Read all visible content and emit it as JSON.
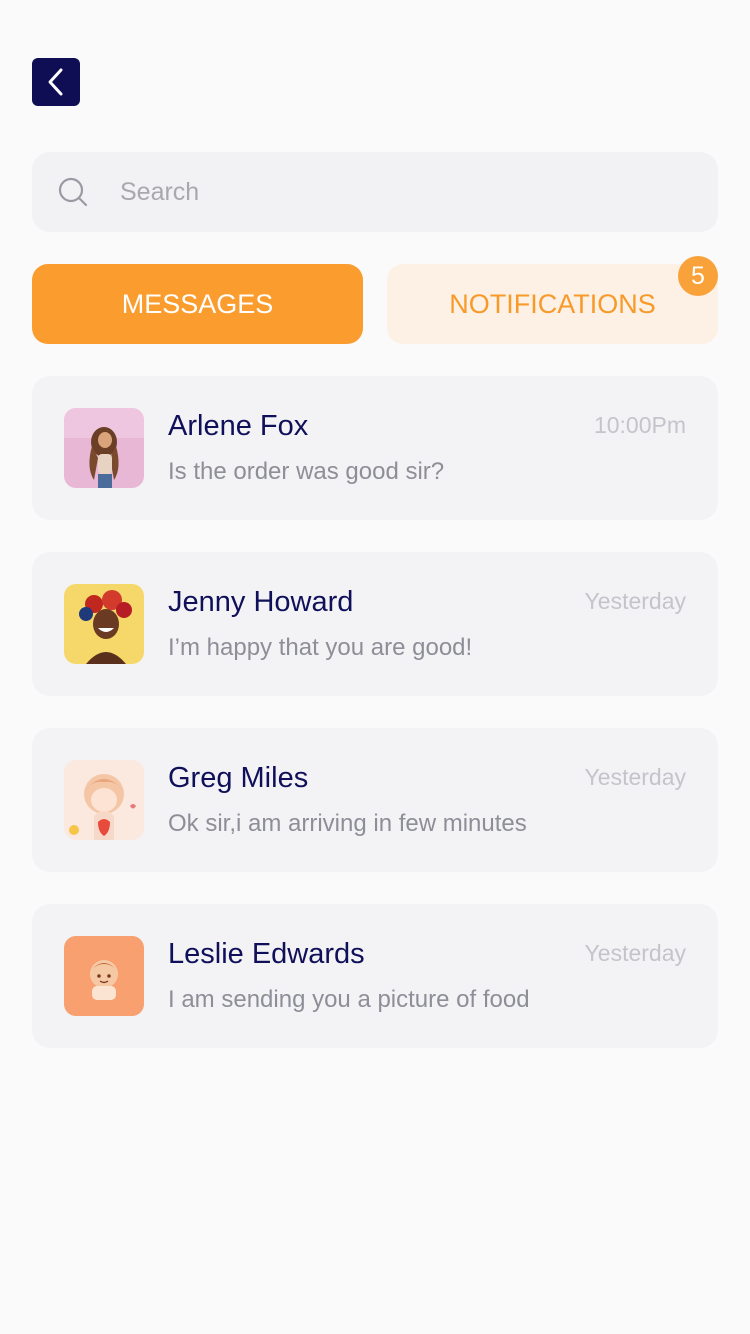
{
  "header": {
    "back_icon": "chevron-left-icon"
  },
  "search": {
    "placeholder": "Search",
    "icon": "search-icon"
  },
  "tabs": {
    "messages_label": "MESSAGES",
    "notifications_label": "NOTIFICATIONS",
    "notifications_badge": "5",
    "active": "messages"
  },
  "colors": {
    "accent": "#fb9c2e",
    "accent_light": "#fdf1e6",
    "navy": "#0f0e55",
    "card_bg": "#f3f3f5"
  },
  "messages": [
    {
      "name": "Arlene Fox",
      "preview": "Is the order was good sir?",
      "time": "10:00Pm"
    },
    {
      "name": "Jenny Howard",
      "preview": "I’m happy that you are good!",
      "time": "Yesterday"
    },
    {
      "name": "Greg Miles",
      "preview": "Ok sir,i am arriving in few minutes",
      "time": "Yesterday"
    },
    {
      "name": "Leslie Edwards",
      "preview": "I am sending you a picture of food",
      "time": "Yesterday"
    }
  ]
}
